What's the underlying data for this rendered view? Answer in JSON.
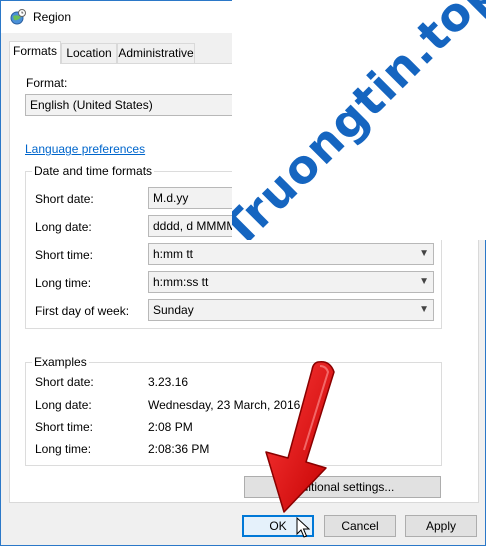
{
  "window": {
    "title": "Region"
  },
  "tabs": [
    {
      "label": "Formats",
      "active": true
    },
    {
      "label": "Location",
      "active": false
    },
    {
      "label": "Administrative",
      "active": false
    }
  ],
  "format": {
    "label": "Format:",
    "value": "English (United States)"
  },
  "language_link": "Language preferences",
  "date_time": {
    "title": "Date and time formats",
    "short_date": {
      "label": "Short date:",
      "value": "M.d.yy"
    },
    "long_date": {
      "label": "Long date:",
      "value": "dddd, d MMMM"
    },
    "short_time": {
      "label": "Short time:",
      "value": "h:mm tt"
    },
    "long_time": {
      "label": "Long time:",
      "value": "h:mm:ss tt"
    },
    "first_day": {
      "label": "First day of week:",
      "value": "Sunday"
    }
  },
  "examples": {
    "title": "Examples",
    "short_date": {
      "label": "Short date:",
      "value": "3.23.16"
    },
    "long_date": {
      "label": "Long date:",
      "value": "Wednesday, 23 March, 2016"
    },
    "short_time": {
      "label": "Short time:",
      "value": "2:08 PM"
    },
    "long_time": {
      "label": "Long time:",
      "value": "2:08:36 PM"
    }
  },
  "additional_settings": "dditional settings...",
  "buttons": {
    "ok": "OK",
    "cancel": "Cancel",
    "apply": "Apply"
  },
  "watermark": "Truongtin.top",
  "colors": {
    "accent": "#0078d7",
    "watermark": "#1565c0",
    "arrow": "#e00000"
  }
}
